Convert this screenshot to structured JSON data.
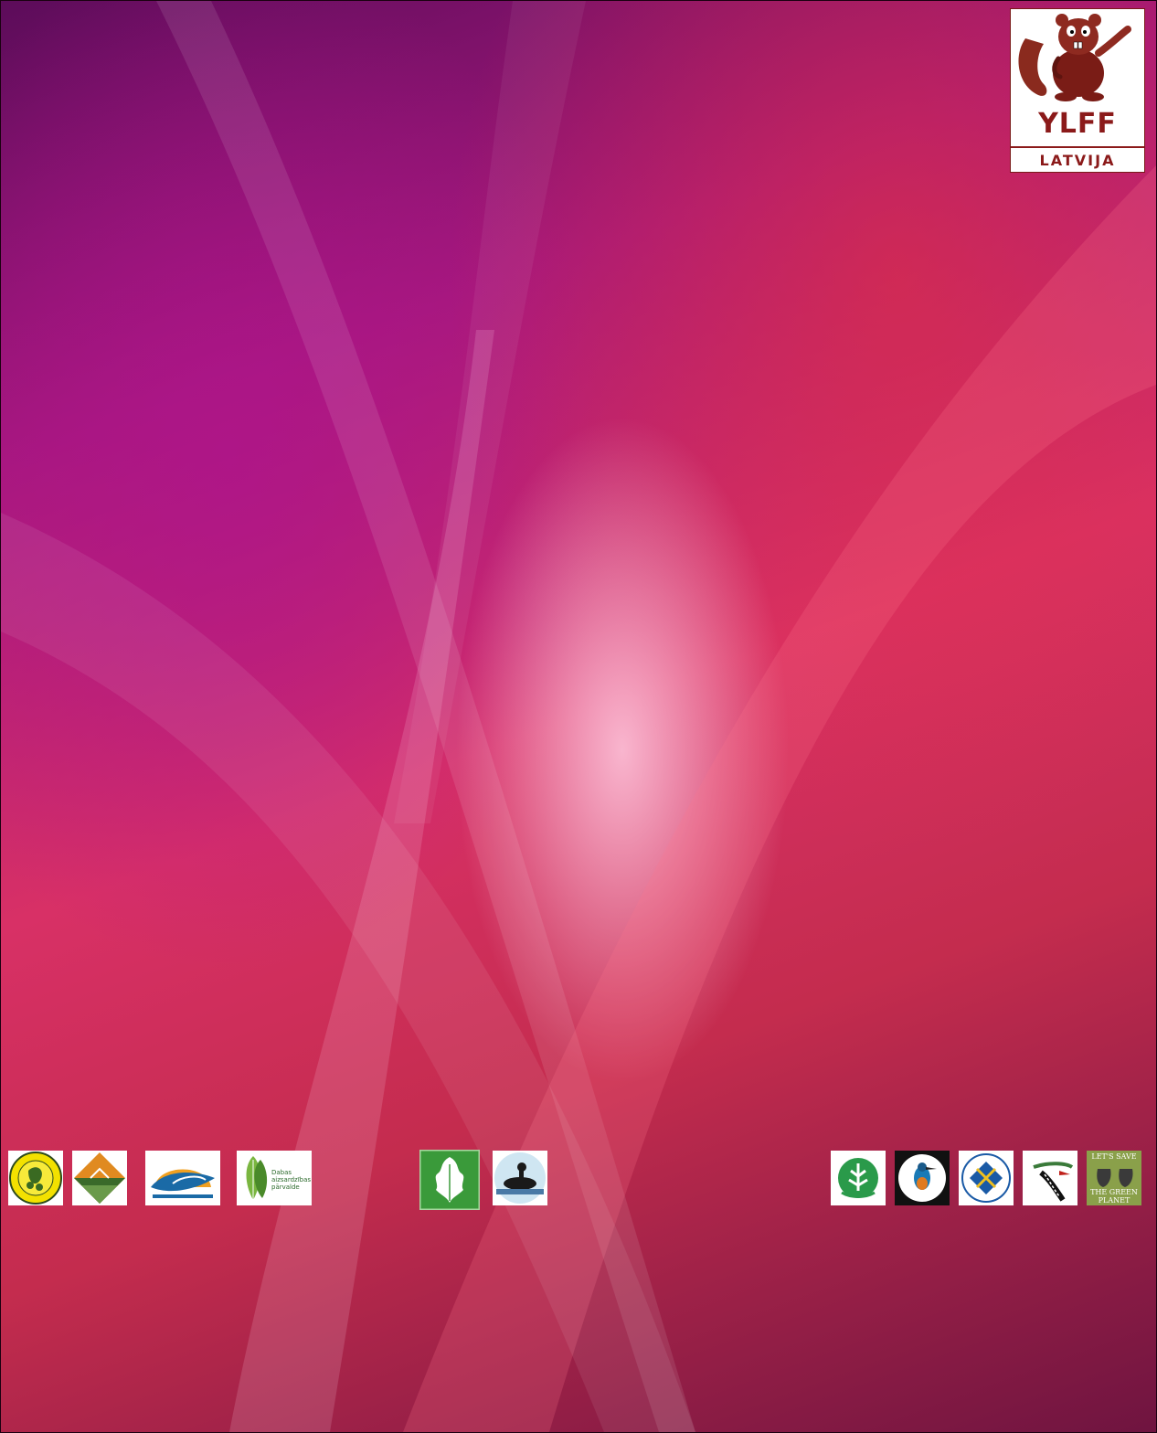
{
  "brand": {
    "name": "YLFF",
    "country": "LATVIJA",
    "brown": "#8b1a1a"
  },
  "background": {
    "colors": [
      "#5c0c5a",
      "#a5187c",
      "#d83066",
      "#c42c4e",
      "#6f1440"
    ]
  },
  "partner_logos": {
    "save_logo": {
      "line1": "LET'S SAVE",
      "line2": "THE GREEN",
      "line3": "PLANET EARTH"
    },
    "dabas_logo": {
      "line1": "Dabas",
      "line2": "aizsardzības",
      "line3": "pārvalde"
    }
  }
}
